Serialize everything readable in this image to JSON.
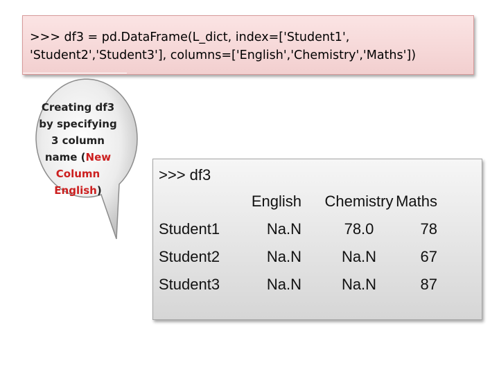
{
  "code": {
    "line1": ">>> df3 = pd.DataFrame(L_dict, index=['Student1',",
    "line2": "'Student2','Student3'], columns=['English','Chemistry','Maths'])"
  },
  "callout": {
    "text_before": "Creating df3 by specifying 3 column name (",
    "highlight": "New Column English",
    "text_after": ")",
    "highlight_color": "#cc1f1f"
  },
  "result": {
    "prompt": ">>> df3",
    "columns": [
      "English",
      "Chemistry",
      "Maths"
    ],
    "rows": [
      {
        "index": "Student1",
        "values": [
          "Na.N",
          "78.0",
          "78"
        ]
      },
      {
        "index": "Student2",
        "values": [
          "Na.N",
          "Na.N",
          "67"
        ]
      },
      {
        "index": "Student3",
        "values": [
          "Na.N",
          "Na.N",
          "87"
        ]
      }
    ]
  }
}
